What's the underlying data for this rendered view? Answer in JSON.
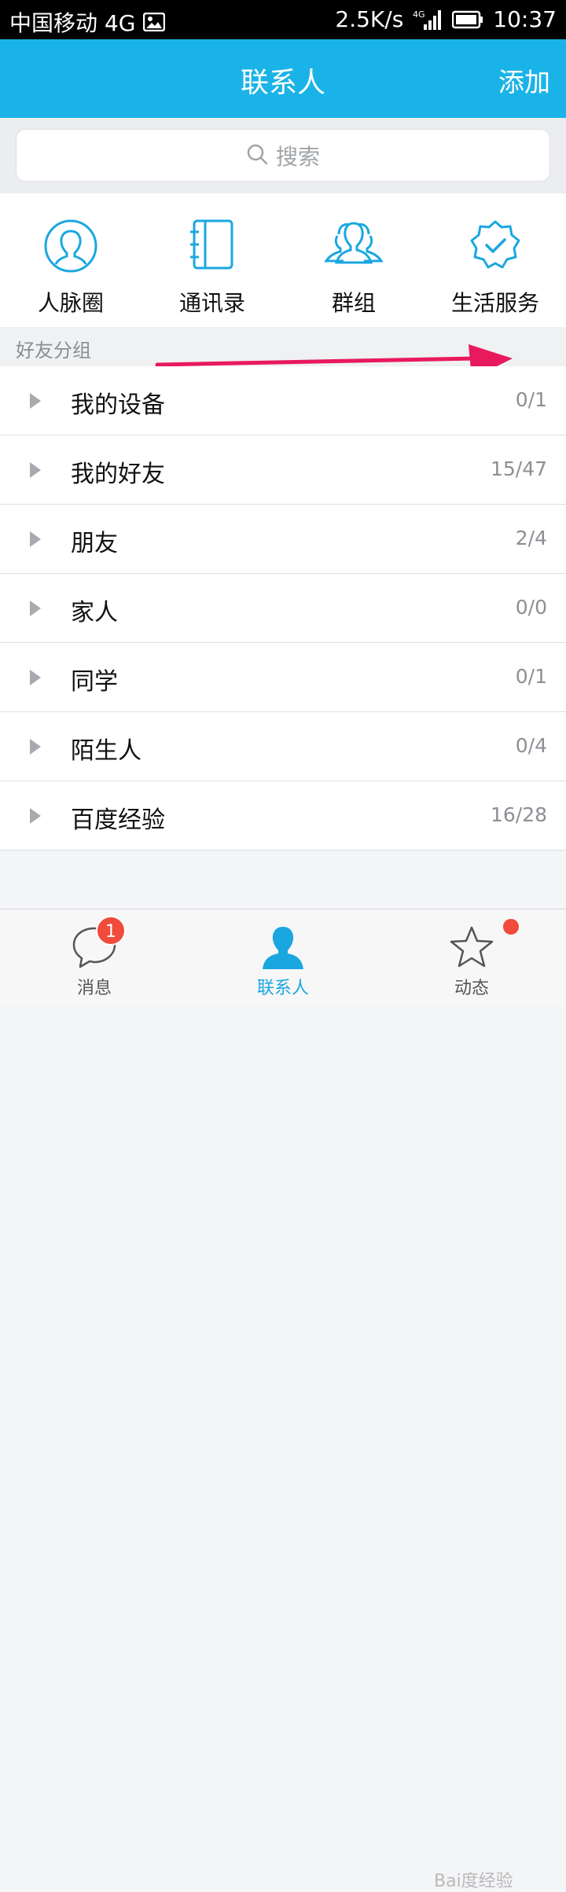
{
  "status_bar": {
    "carrier": "中国移动 4G",
    "speed": "2.5K/s",
    "time": "10:37",
    "icons": [
      "image-notification-icon",
      "4g-signal-icon",
      "battery-icon"
    ]
  },
  "header": {
    "title": "联系人",
    "add_label": "添加",
    "color": "#1ab3e8"
  },
  "search": {
    "placeholder": "搜索"
  },
  "shortcuts": [
    {
      "label": "人脉圈",
      "icon": "person-circle-icon"
    },
    {
      "label": "通讯录",
      "icon": "address-book-icon"
    },
    {
      "label": "群组",
      "icon": "group-icon"
    },
    {
      "label": "生活服务",
      "icon": "badge-check-icon"
    }
  ],
  "section": {
    "title": "好友分组"
  },
  "groups": [
    {
      "name": "我的设备",
      "count": "0/1"
    },
    {
      "name": "我的好友",
      "count": "15/47"
    },
    {
      "name": "朋友",
      "count": "2/4"
    },
    {
      "name": "家人",
      "count": "0/0"
    },
    {
      "name": "同学",
      "count": "0/1"
    },
    {
      "name": "陌生人",
      "count": "0/4"
    },
    {
      "name": "百度经验",
      "count": "16/28"
    }
  ],
  "tabs": [
    {
      "label": "消息",
      "badge": "1",
      "icon": "chat-bubble-icon"
    },
    {
      "label": "联系人",
      "icon": "person-icon",
      "active": true
    },
    {
      "label": "动态",
      "icon": "star-icon",
      "dot": true
    }
  ],
  "watermark": "Bai度经验",
  "colors": {
    "accent": "#1ab3e8",
    "badge": "#f04b3b",
    "annotation_arrow": "#e8195c"
  }
}
